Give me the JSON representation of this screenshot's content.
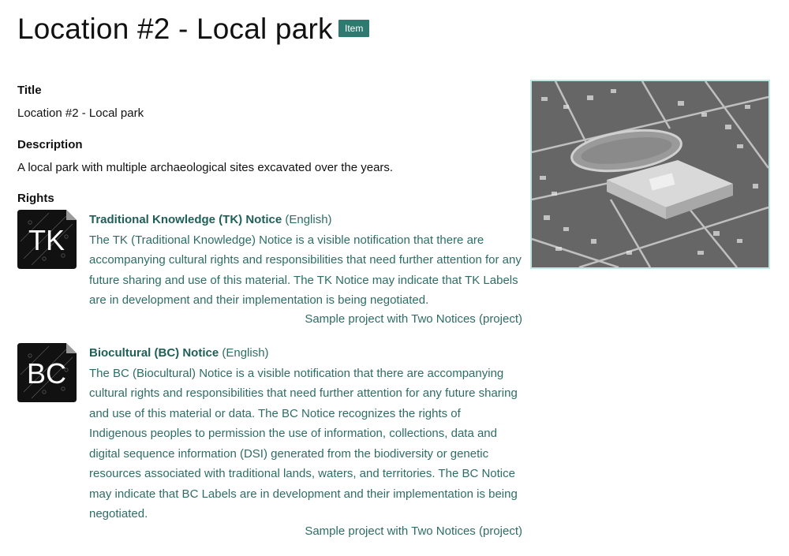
{
  "page": {
    "title": "Location #2 - Local park",
    "badge": "Item"
  },
  "fields": {
    "title_label": "Title",
    "title_value": "Location #2 - Local park",
    "description_label": "Description",
    "description_value": "A local park with multiple archaeological sites excavated over the years.",
    "rights_label": "Rights"
  },
  "notices": [
    {
      "icon_text": "TK",
      "title": "Traditional Knowledge (TK) Notice",
      "language": "(English)",
      "description": "The TK (Traditional Knowledge) Notice is a visible notification that there are accompanying cultural rights and responsibilities that need further attention for any future sharing and use of this material. The TK Notice may indicate that TK Labels are in development and their implementation is being negotiated.",
      "project": "Sample project with Two Notices (project)"
    },
    {
      "icon_text": "BC",
      "title": "Biocultural (BC) Notice",
      "language": "(English)",
      "description": "The BC (Biocultural) Notice is a visible notification that there are accompanying cultural rights and responsibilities that need further attention for any future sharing and use of this material or data. The BC Notice recognizes the rights of Indigenous peoples to permission the use of information, collections, data and digital sequence information (DSI) generated from the biodiversity or genetic resources associated with traditional lands, waters, and territories. The BC Notice may indicate that BC Labels are in development and their implementation is being negotiated.",
      "project": "Sample project with Two Notices (project)"
    }
  ],
  "colors": {
    "accent": "#2e7a70",
    "link_text": "#2e6d66",
    "image_border": "#bfe8e4"
  }
}
